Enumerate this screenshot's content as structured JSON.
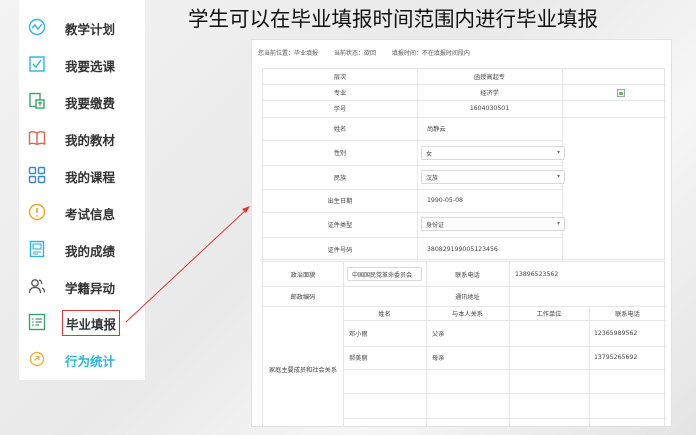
{
  "title": "学生可以在毕业填报时间范围内进行毕业填报",
  "sidebar": {
    "items": [
      {
        "label": "教学计划",
        "icon": "chart-wave-icon"
      },
      {
        "label": "我要选课",
        "icon": "checkbox-icon"
      },
      {
        "label": "我要缴费",
        "icon": "payment-icon"
      },
      {
        "label": "我的教材",
        "icon": "book-icon"
      },
      {
        "label": "我的课程",
        "icon": "grid-icon"
      },
      {
        "label": "考试信息",
        "icon": "info-icon"
      },
      {
        "label": "我的成绩",
        "icon": "score-icon"
      },
      {
        "label": "学籍异动",
        "icon": "users-icon"
      },
      {
        "label": "毕业填报",
        "icon": "form-list-icon"
      },
      {
        "label": "行为统计",
        "icon": "link-icon"
      }
    ],
    "active_label": "毕业填报"
  },
  "status": {
    "location": "您当前位置：毕业填报",
    "state": "当前状态：欲回",
    "period": "填报时间：不在填报时间段内"
  },
  "form": {
    "level_label": "层次",
    "level_value": "函授高起专",
    "major_label": "专业",
    "major_value": "经济学",
    "student_no_label": "学号",
    "student_no_value": "1604030501",
    "name_label": "姓名",
    "name_value": "尚静云",
    "gender_label": "性别",
    "gender_value": "女",
    "ethnicity_label": "民族",
    "ethnicity_value": "汉族",
    "birth_label": "出生日期",
    "birth_value": "1990-05-08",
    "id_type_label": "证件类型",
    "id_type_value": "身份证",
    "id_no_label": "证件号码",
    "id_no_value": "380829199005123456",
    "political_label": "政治面貌",
    "political_value": "中国国民党革命委员会",
    "phone_label": "联系电话",
    "phone_value": "13896523562",
    "postcode_label": "邮政编码",
    "postcode_value": "",
    "address_label": "通讯地址",
    "address_value": "",
    "family_label": "家庭主要成员和社会关系",
    "family_headers": [
      "姓名",
      "与本人关系",
      "工作单位",
      "联系电话"
    ],
    "family_rows": [
      {
        "name": "邓小雨",
        "relation": "父亲",
        "work": "",
        "phone": "12365989562"
      },
      {
        "name": "郝美丽",
        "relation": "母亲",
        "work": "",
        "phone": "13795265692"
      }
    ]
  },
  "colors": {
    "accent_cyan": "#2bb6d8",
    "annotation_red": "#d23b33"
  }
}
